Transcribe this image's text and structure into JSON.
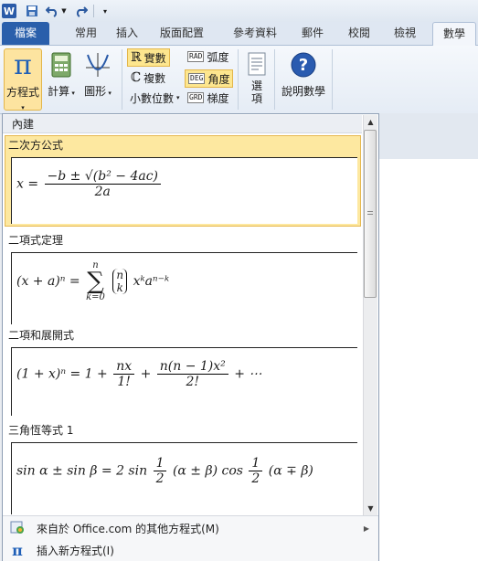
{
  "qat": {
    "app_icon": "W"
  },
  "tabs": [
    "檔案",
    "常用",
    "插入",
    "版面配置",
    "參考資料",
    "郵件",
    "校閱",
    "檢視",
    "數學"
  ],
  "ribbon": {
    "equation": "方程式",
    "compute": "計算",
    "graph": "圖形",
    "real": "實數",
    "complex": "複數",
    "decimal": "小數位數",
    "rad": "弧度",
    "deg": "角度",
    "grd": "梯度",
    "rad_chip": "RAD",
    "deg_chip": "DEG",
    "grd_chip": "GRD",
    "options": "選\n項",
    "help": "說明數學"
  },
  "panel": {
    "header": "內建",
    "sections": [
      {
        "title": "二次方公式"
      },
      {
        "title": "二項式定理"
      },
      {
        "title": "二項和展開式"
      },
      {
        "title": "三角恆等式 1"
      }
    ]
  },
  "equations": {
    "quad_lhs": "x =",
    "quad_num": "−b ± √(b² − 4ac)",
    "quad_den": "2a",
    "binom_lhs": "(x + a)ⁿ =",
    "binom_sum_top": "n",
    "binom_sum_bot": "k=0",
    "binom_top": "n",
    "binom_bot": "k",
    "binom_tail": "xᵏaⁿ⁻ᵏ",
    "exp_lhs": "(1 + x)ⁿ = 1 +",
    "exp_f1n": "nx",
    "exp_f1d": "1!",
    "exp_f2n": "n(n − 1)x²",
    "exp_f2d": "2!",
    "exp_tail": "+ ⋯",
    "trig_lhs": "sin α ± sin β = 2 sin",
    "trig_f1n": "1",
    "trig_f1d": "2",
    "trig_mid": "(α ± β) cos",
    "trig_f2n": "1",
    "trig_f2d": "2",
    "trig_tail": "(α ∓ β)"
  },
  "footer": {
    "more": "來自於 Office.com 的其他方程式(M)",
    "insert": "插入新方程式(I)"
  }
}
